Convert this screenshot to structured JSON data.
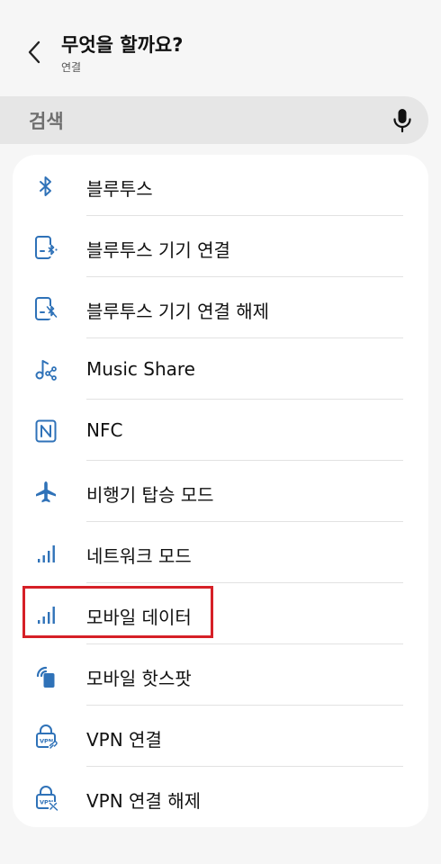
{
  "header": {
    "title": "무엇을 할까요?",
    "subtitle": "연결",
    "back_icon": "chevron-left-icon"
  },
  "search": {
    "placeholder": "검색",
    "mic_icon": "microphone-icon"
  },
  "list": {
    "items": [
      {
        "label": "블루투스",
        "icon": "bluetooth-icon"
      },
      {
        "label": "블루투스 기기 연결",
        "icon": "bluetooth-device-connect-icon"
      },
      {
        "label": "블루투스 기기 연결 해제",
        "icon": "bluetooth-device-disconnect-icon"
      },
      {
        "label": "Music Share",
        "icon": "music-share-icon"
      },
      {
        "label": "NFC",
        "icon": "nfc-icon"
      },
      {
        "label": "비행기 탑승 모드",
        "icon": "airplane-icon"
      },
      {
        "label": "네트워크 모드",
        "icon": "signal-bars-icon"
      },
      {
        "label": "모바일 데이터",
        "icon": "signal-bars-icon"
      },
      {
        "label": "모바일 핫스팟",
        "icon": "hotspot-icon"
      },
      {
        "label": "VPN 연결",
        "icon": "vpn-connect-icon"
      },
      {
        "label": "VPN 연결 해제",
        "icon": "vpn-disconnect-icon"
      }
    ],
    "highlighted_item": "모바일 데이터"
  },
  "colors": {
    "icon_blue": "#2f72b8",
    "highlight_red": "#d62027",
    "background": "#f6f6f6",
    "card": "#ffffff"
  }
}
